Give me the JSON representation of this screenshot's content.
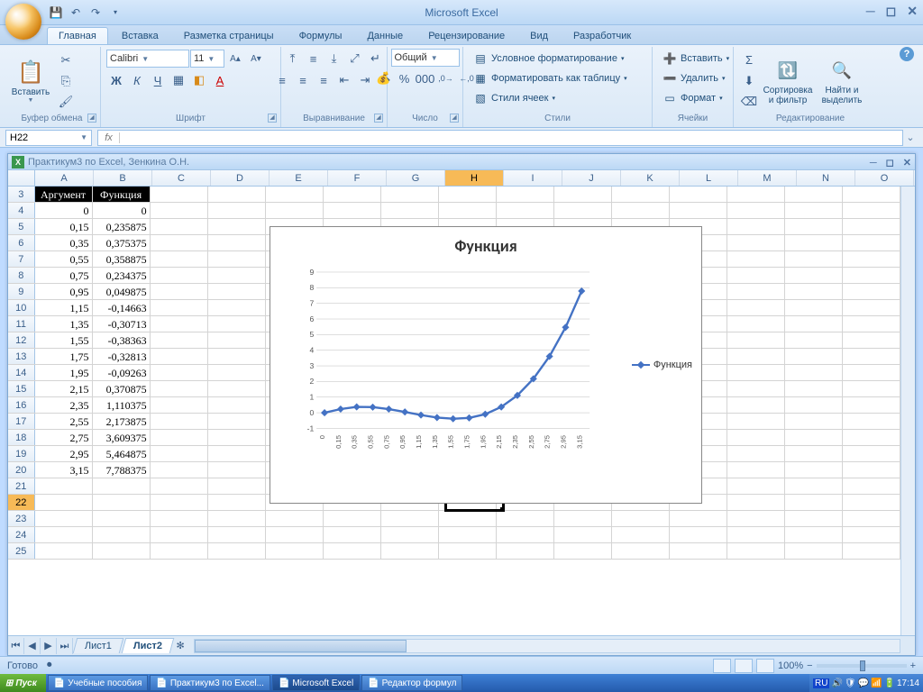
{
  "app_title": "Microsoft Excel",
  "tabs": [
    "Главная",
    "Вставка",
    "Разметка страницы",
    "Формулы",
    "Данные",
    "Рецензирование",
    "Вид",
    "Разработчик"
  ],
  "active_tab": 0,
  "ribbon": {
    "clipboard": {
      "paste": "Вставить",
      "label": "Буфер обмена"
    },
    "font": {
      "name": "Calibri",
      "size": "11",
      "label": "Шрифт"
    },
    "align": {
      "label": "Выравнивание"
    },
    "number": {
      "format": "Общий",
      "label": "Число"
    },
    "styles": {
      "cond": "Условное форматирование",
      "table": "Форматировать как таблицу",
      "cell": "Стили ячеек",
      "label": "Стили"
    },
    "cells": {
      "insert": "Вставить",
      "delete": "Удалить",
      "format": "Формат",
      "label": "Ячейки"
    },
    "editing": {
      "sort": "Сортировка и фильтр",
      "find": "Найти и выделить",
      "label": "Редактирование"
    }
  },
  "namebox": "H22",
  "formula": "",
  "workbook_title": "Практикум3 по Excel, Зенкина О.Н.",
  "columns": [
    "A",
    "B",
    "C",
    "D",
    "E",
    "F",
    "G",
    "H",
    "I",
    "J",
    "K",
    "L",
    "M",
    "N",
    "O"
  ],
  "headers": {
    "arg": "Аргумент",
    "fn": "Функция"
  },
  "rows": [
    {
      "n": 3,
      "a": "",
      "b": ""
    },
    {
      "n": 4,
      "a": "0",
      "b": "0"
    },
    {
      "n": 5,
      "a": "0,15",
      "b": "0,235875"
    },
    {
      "n": 6,
      "a": "0,35",
      "b": "0,375375"
    },
    {
      "n": 7,
      "a": "0,55",
      "b": "0,358875"
    },
    {
      "n": 8,
      "a": "0,75",
      "b": "0,234375"
    },
    {
      "n": 9,
      "a": "0,95",
      "b": "0,049875"
    },
    {
      "n": 10,
      "a": "1,15",
      "b": "-0,14663"
    },
    {
      "n": 11,
      "a": "1,35",
      "b": "-0,30713"
    },
    {
      "n": 12,
      "a": "1,55",
      "b": "-0,38363"
    },
    {
      "n": 13,
      "a": "1,75",
      "b": "-0,32813"
    },
    {
      "n": 14,
      "a": "1,95",
      "b": "-0,09263"
    },
    {
      "n": 15,
      "a": "2,15",
      "b": "0,370875"
    },
    {
      "n": 16,
      "a": "2,35",
      "b": "1,110375"
    },
    {
      "n": 17,
      "a": "2,55",
      "b": "2,173875"
    },
    {
      "n": 18,
      "a": "2,75",
      "b": "3,609375"
    },
    {
      "n": 19,
      "a": "2,95",
      "b": "5,464875"
    },
    {
      "n": 20,
      "a": "3,15",
      "b": "7,788375"
    }
  ],
  "extra_rows": [
    21,
    22,
    23,
    24,
    25
  ],
  "selected_row": 22,
  "selected_col": "H",
  "sheet_tabs": [
    "Лист1",
    "Лист2"
  ],
  "active_sheet": 1,
  "status_text": "Готово",
  "zoom": "100%",
  "taskbar": {
    "start": "Пуск",
    "items": [
      "Учебные пособия",
      "Практикум3 по Excel...",
      "Microsoft Excel",
      "Редактор формул"
    ],
    "active": 2,
    "lang": "RU",
    "time": "17:14"
  },
  "chart_data": {
    "type": "line",
    "title": "Функция",
    "legend": "Функция",
    "ylim": [
      -1,
      9
    ],
    "yticks": [
      -1,
      0,
      1,
      2,
      3,
      4,
      5,
      6,
      7,
      8,
      9
    ],
    "categories": [
      "0",
      "0,15",
      "0,35",
      "0,55",
      "0,75",
      "0,95",
      "1,15",
      "1,35",
      "1,55",
      "1,75",
      "1,95",
      "2,15",
      "2,35",
      "2,55",
      "2,75",
      "2,95",
      "3,15"
    ],
    "values": [
      0,
      0.235875,
      0.375375,
      0.358875,
      0.234375,
      0.049875,
      -0.14663,
      -0.30713,
      -0.38363,
      -0.32813,
      -0.09263,
      0.370875,
      1.110375,
      2.173875,
      3.609375,
      5.464875,
      7.788375
    ]
  }
}
